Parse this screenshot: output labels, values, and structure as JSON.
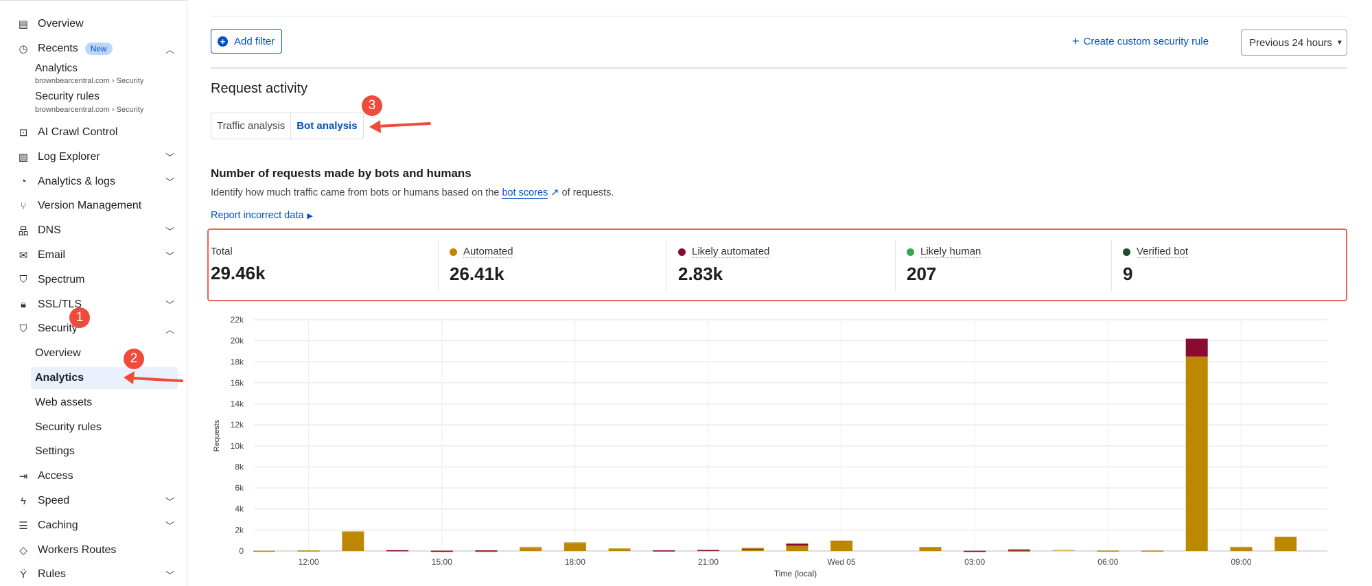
{
  "sidebar": {
    "overview": "Overview",
    "recents": {
      "label": "Recents",
      "badge": "New",
      "items": [
        {
          "title": "Analytics",
          "crumb": "brownbearcentral.com › Security"
        },
        {
          "title": "Security rules",
          "crumb": "brownbearcentral.com › Security"
        }
      ]
    },
    "items": [
      {
        "label": "AI Crawl Control",
        "icon": "robot-icon"
      },
      {
        "label": "Log Explorer",
        "icon": "log-icon",
        "expand": true
      },
      {
        "label": "Analytics & logs",
        "icon": "pie-icon",
        "expand": true
      },
      {
        "label": "Version Management",
        "icon": "branch-icon"
      },
      {
        "label": "DNS",
        "icon": "network-icon",
        "expand": true
      },
      {
        "label": "Email",
        "icon": "mail-icon",
        "expand": true
      },
      {
        "label": "Spectrum",
        "icon": "shield-gear-icon"
      },
      {
        "label": "SSL/TLS",
        "icon": "lock-icon",
        "expand": true
      },
      {
        "label": "Security",
        "icon": "shield-icon",
        "expanded": true
      },
      {
        "label": "Access",
        "icon": "login-icon"
      },
      {
        "label": "Speed",
        "icon": "bolt-icon",
        "expand": true
      },
      {
        "label": "Caching",
        "icon": "stack-icon",
        "expand": true
      },
      {
        "label": "Workers Routes",
        "icon": "workers-icon"
      },
      {
        "label": "Rules",
        "icon": "rules-icon",
        "expand": true
      }
    ],
    "security_sub": [
      "Overview",
      "Analytics",
      "Web assets",
      "Security rules",
      "Settings"
    ]
  },
  "toolbar": {
    "add_filter": "Add filter",
    "create_rule": "Create custom security rule",
    "time_range": "Previous 24 hours"
  },
  "section": {
    "title": "Request activity",
    "tabs": [
      "Traffic analysis",
      "Bot analysis"
    ],
    "active_tab": "Bot analysis"
  },
  "bots": {
    "heading": "Number of requests made by bots and humans",
    "desc_pre": "Identify how much traffic came from bots or humans based on the ",
    "desc_link": "bot scores",
    "desc_post": " of requests.",
    "report": "Report incorrect data"
  },
  "stats": [
    {
      "label": "Total",
      "value": "29.46k"
    },
    {
      "label": "Automated",
      "value": "26.41k",
      "color": "#bd8800"
    },
    {
      "label": "Likely automated",
      "value": "2.83k",
      "color": "#8a0a30"
    },
    {
      "label": "Likely human",
      "value": "207",
      "color": "#34a853"
    },
    {
      "label": "Verified bot",
      "value": "9",
      "color": "#1b4d2e"
    }
  ],
  "annotations": [
    "1",
    "2",
    "3"
  ],
  "chart_data": {
    "type": "bar",
    "stacked": true,
    "ylabel": "Requests",
    "xlabel": "Time (local)",
    "ylim": [
      0,
      22000
    ],
    "yticks": [
      "0",
      "2k",
      "4k",
      "6k",
      "8k",
      "10k",
      "12k",
      "14k",
      "16k",
      "18k",
      "20k",
      "22k"
    ],
    "xticks": [
      {
        "at": "12:00",
        "label": "12:00"
      },
      {
        "at": "15:00",
        "label": "15:00"
      },
      {
        "at": "18:00",
        "label": "18:00"
      },
      {
        "at": "21:00",
        "label": "21:00"
      },
      {
        "at": "00:00",
        "label": "Wed 05"
      },
      {
        "at": "03:00",
        "label": "03:00"
      },
      {
        "at": "06:00",
        "label": "06:00"
      },
      {
        "at": "09:00",
        "label": "09:00"
      }
    ],
    "x": [
      "11:00",
      "12:00",
      "13:00",
      "14:00",
      "15:00",
      "16:00",
      "17:00",
      "18:00",
      "19:00",
      "20:00",
      "21:00",
      "22:00",
      "23:00",
      "00:00",
      "01:00",
      "02:00",
      "03:00",
      "04:00",
      "05:00",
      "06:00",
      "07:00",
      "08:00",
      "09:00",
      "10:00"
    ],
    "grid": true,
    "series": [
      {
        "name": "Automated",
        "color": "#bd8800",
        "values": [
          20,
          50,
          1850,
          60,
          10,
          10,
          330,
          820,
          240,
          50,
          80,
          220,
          520,
          900,
          0,
          380,
          10,
          30,
          100,
          40,
          40,
          18500,
          280,
          1350
        ]
      },
      {
        "name": "Likely automated",
        "color": "#8a0a30",
        "values": [
          0,
          0,
          0,
          20,
          20,
          50,
          0,
          0,
          0,
          10,
          20,
          20,
          200,
          80,
          0,
          0,
          10,
          120,
          0,
          0,
          0,
          1700,
          100,
          0
        ]
      },
      {
        "name": "Likely human",
        "color": "#d9b870",
        "values": [
          0,
          0,
          50,
          0,
          0,
          0,
          80,
          30,
          0,
          0,
          0,
          80,
          50,
          30,
          0,
          0,
          0,
          0,
          10,
          0,
          0,
          0,
          30,
          0
        ]
      }
    ]
  }
}
